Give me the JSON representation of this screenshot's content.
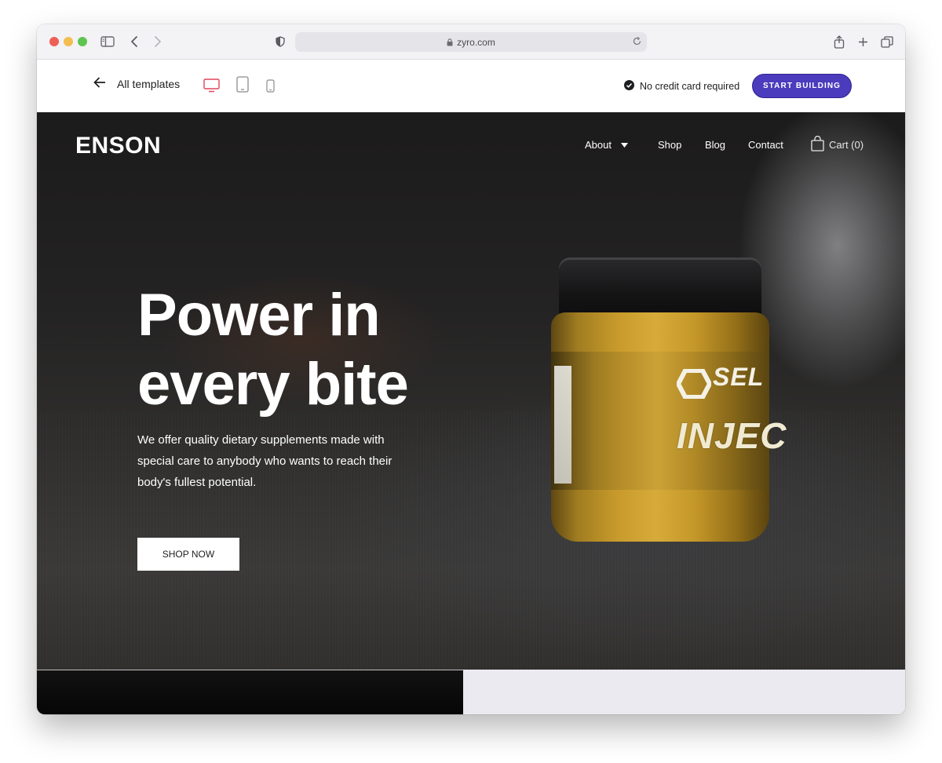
{
  "browser": {
    "url": "zyro.com"
  },
  "template_bar": {
    "back_label": "All templates",
    "no_card_text": "No credit card required",
    "cta_label": "START BUILDING",
    "accent_color": "#4b3bbd",
    "active_device_color": "#e0455b"
  },
  "site": {
    "logo": "ENSON",
    "nav": {
      "about": "About",
      "shop": "Shop",
      "blog": "Blog",
      "contact": "Contact",
      "cart": "Cart (0)"
    },
    "hero": {
      "headline_line1": "Power in",
      "headline_line2": "every bite",
      "subtitle": "We offer quality dietary supplements made with special care to anybody who wants to reach their body's fullest potential.",
      "button": "SHOP NOW"
    },
    "product": {
      "brand": "SEL",
      "name": "INJEC"
    }
  }
}
